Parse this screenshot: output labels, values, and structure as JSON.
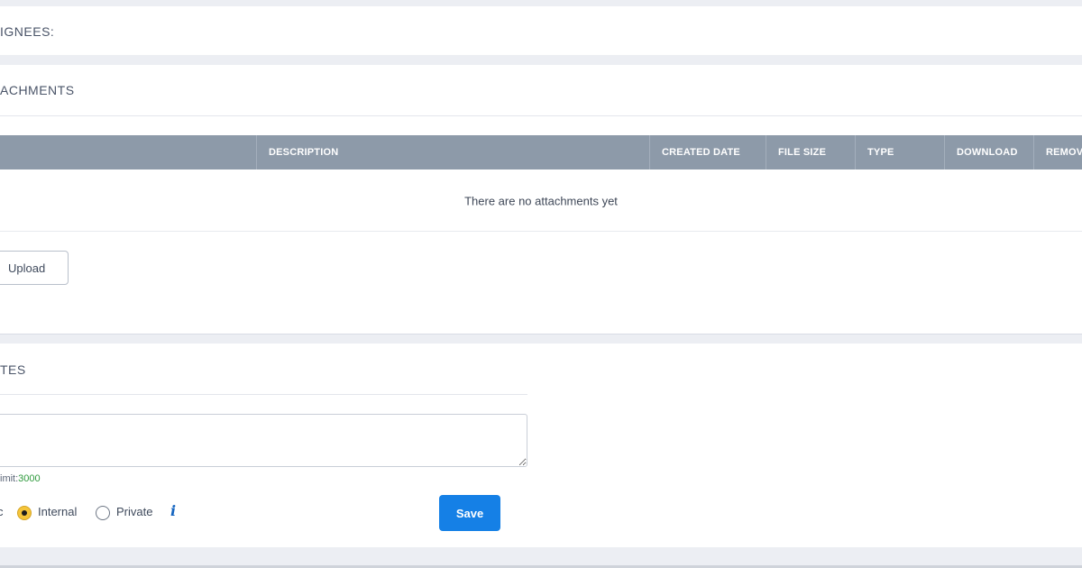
{
  "assignees": {
    "title": "IGNEES:"
  },
  "attachments": {
    "title": "ACHMENTS",
    "columns": [
      "DESCRIPTION",
      "CREATED DATE",
      "FILE SIZE",
      "TYPE",
      "DOWNLOAD",
      "REMOV"
    ],
    "empty_message": "There are no attachments yet",
    "upload_label": "Upload"
  },
  "notes": {
    "title": "TES",
    "textarea_value": "",
    "char_limit_label": "imit:",
    "char_limit_value": "3000",
    "visibility": {
      "clipped_option": "c",
      "options": [
        "Internal",
        "Private"
      ],
      "selected": "Internal"
    },
    "info_icon": "info-icon",
    "save_label": "Save"
  },
  "colors": {
    "header_bg": "#8d9aa9",
    "save_button": "#1580e6",
    "radio_checked": "#f5c53a",
    "char_limit_number": "#2f9a3d",
    "info_icon": "#1565c0"
  }
}
